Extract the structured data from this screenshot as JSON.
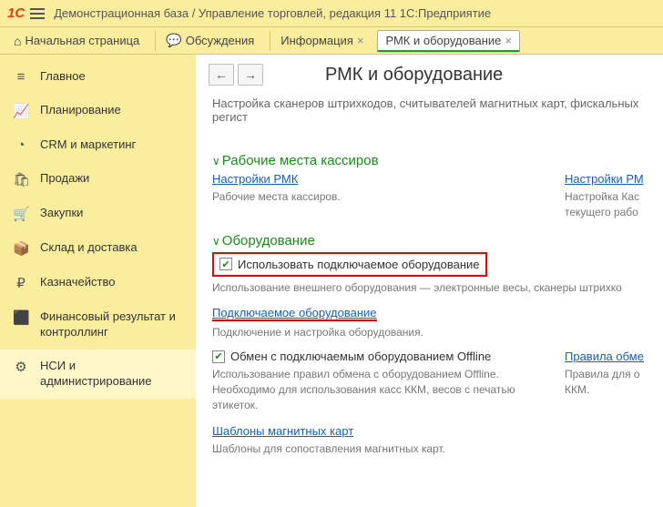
{
  "app": {
    "title": "Демонстрационная база / Управление торговлей, редакция 11 1С:Предприятие",
    "logo": "1C"
  },
  "tabs": {
    "home": "Начальная страница",
    "discussions": "Обсуждения",
    "info": "Информация",
    "rmk": "РМК и оборудование"
  },
  "sidebar": {
    "items": [
      {
        "label": "Главное"
      },
      {
        "label": "Планирование"
      },
      {
        "label": "CRM и маркетинг"
      },
      {
        "label": "Продажи"
      },
      {
        "label": "Закупки"
      },
      {
        "label": "Склад и доставка"
      },
      {
        "label": "Казначейство"
      },
      {
        "label": "Финансовый результат и контроллинг"
      },
      {
        "label": "НСИ и администрирование"
      }
    ]
  },
  "page": {
    "title": "РМК и оборудование",
    "description": "Настройка сканеров штрихкодов, считывателей магнитных карт, фискальных регист"
  },
  "sections": {
    "cashier": {
      "title": "Рабочие места кассиров",
      "left": {
        "link": "Настройки РМК",
        "desc": "Рабочие места кассиров."
      },
      "right": {
        "link": "Настройки РМ",
        "desc1": "Настройка Кас",
        "desc2": "текущего рабо"
      }
    },
    "equipment": {
      "title": "Оборудование",
      "opt_use_equip": "Использовать подключаемое оборудование",
      "use_equip_desc": "Использование внешнего оборудования — электронные весы, сканеры штрихко",
      "plug_link": "Подключаемое оборудование",
      "plug_desc": "Подключение и настройка оборудования.",
      "offline_label": "Обмен с подключаемым оборудованием Offline",
      "offline_desc": "Использование правил обмена с оборудованием Offline. Необходимо для использования касс ККМ, весов с печатью этикеток.",
      "rules_link": "Правила обме",
      "rules_desc1": "Правила для о",
      "rules_desc2": "ККМ.",
      "templates_link": "Шаблоны магнитных карт",
      "templates_desc": "Шаблоны для сопоставления магнитных карт."
    }
  }
}
